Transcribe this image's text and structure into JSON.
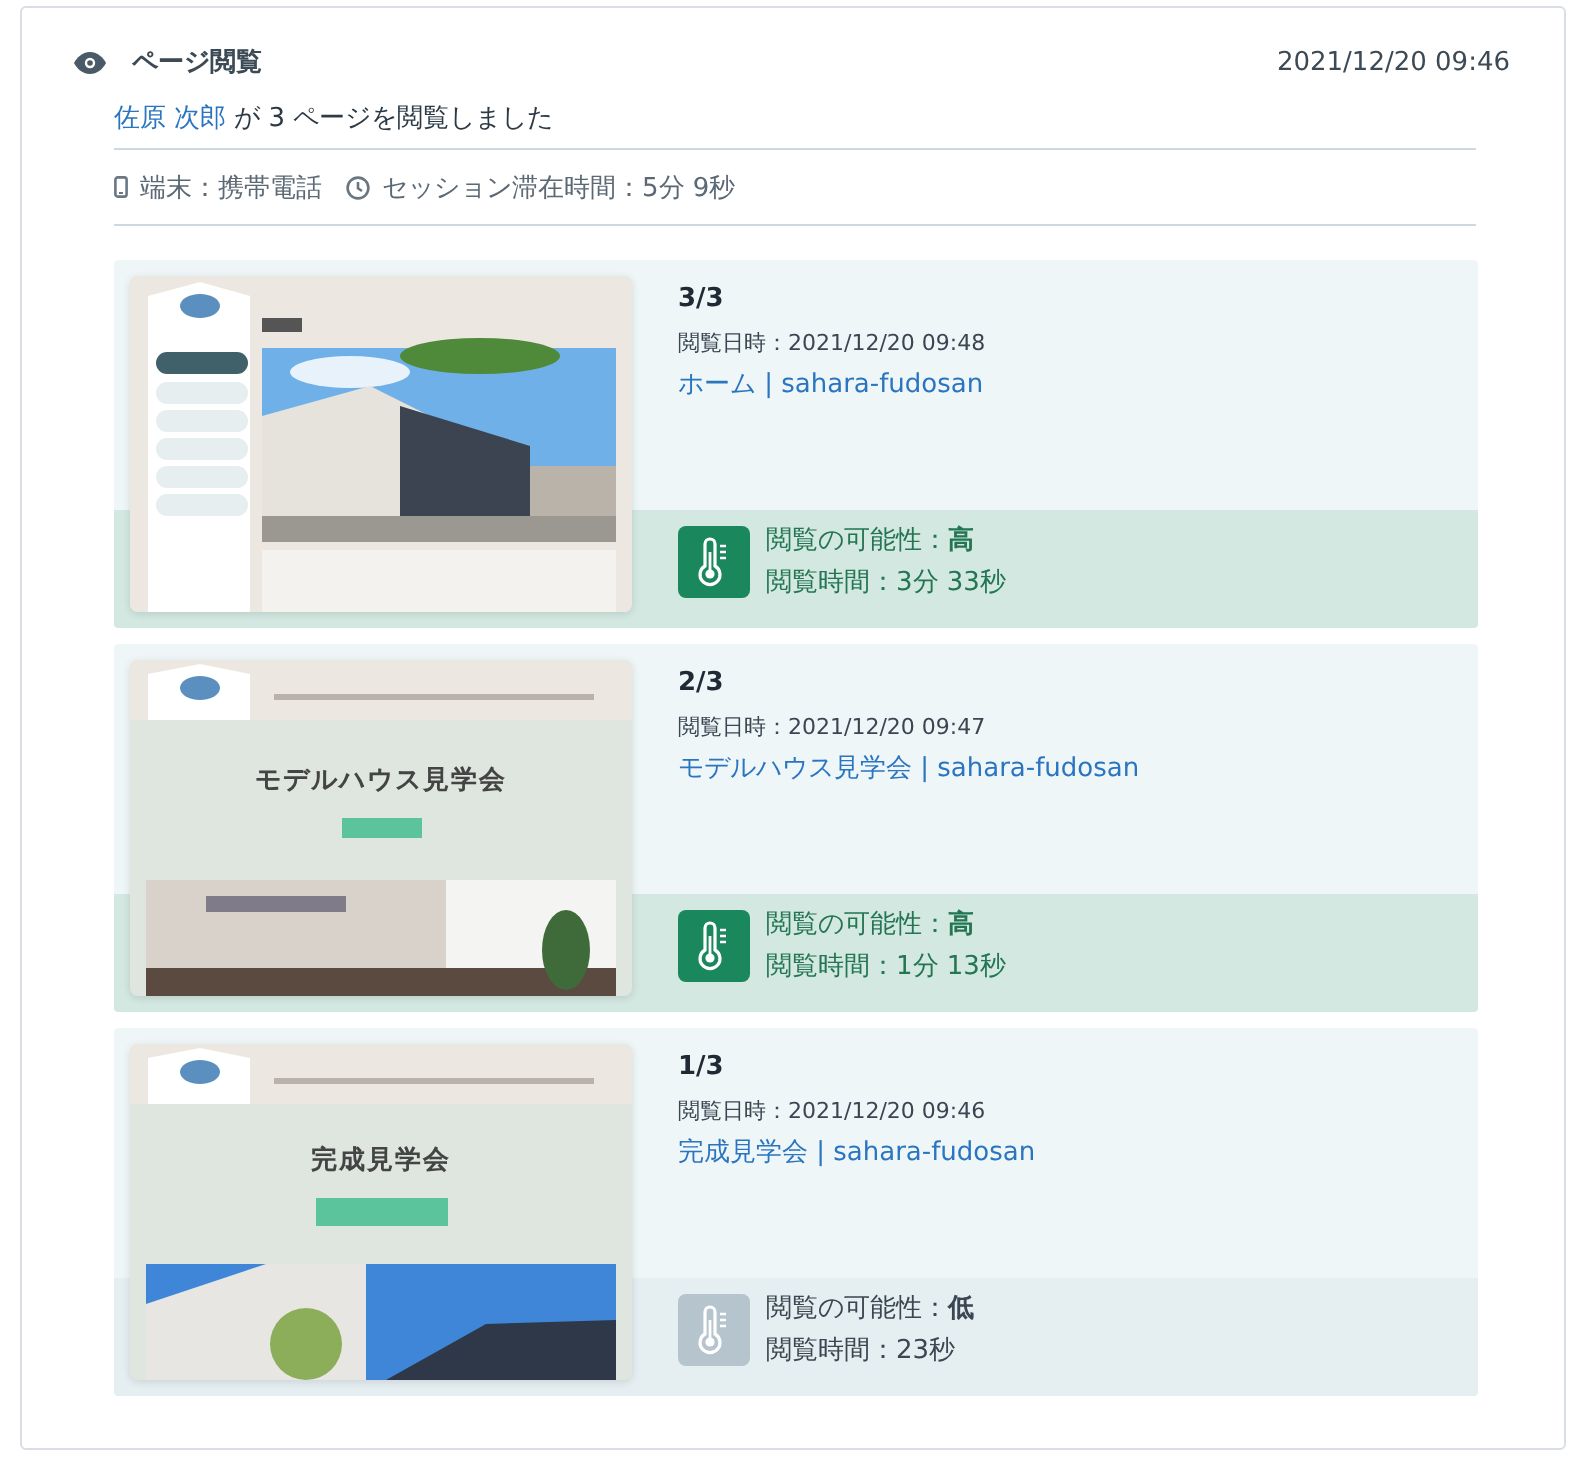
{
  "header": {
    "title": "ページ閲覧",
    "datetime": "2021/12/20 09:46"
  },
  "summary": {
    "user": "佐原 次郎",
    "text": "が 3 ページを閲覧しました"
  },
  "meta": [
    {
      "kind": "device",
      "text": "端末：携帯電話"
    },
    {
      "kind": "session",
      "text": "セッション滞在時間：5分 9秒"
    }
  ],
  "pages": [
    {
      "index": "3/3",
      "viewed_at": "閲覧日時：2021/12/20 09:48",
      "link": "ホーム | sahara-fudosan",
      "likelihood_label": "閲覧の可能性：",
      "likelihood": "高",
      "hot": true,
      "duration": "閲覧時間：3分 33秒",
      "thumbnail": {
        "kind": "home"
      }
    },
    {
      "index": "2/3",
      "viewed_at": "閲覧日時：2021/12/20 09:47",
      "link": "モデルハウス見学会 | sahara-fudosan",
      "likelihood_label": "閲覧の可能性：",
      "likelihood": "高",
      "hot": true,
      "duration": "閲覧時間：1分 13秒",
      "thumbnail": {
        "kind": "event",
        "heading": "モデルハウス見学会"
      }
    },
    {
      "index": "1/3",
      "viewed_at": "閲覧日時：2021/12/20 09:46",
      "link": "完成見学会 | sahara-fudosan",
      "likelihood_label": "閲覧の可能性：",
      "likelihood": "低",
      "hot": false,
      "duration": "閲覧時間：23秒",
      "thumbnail": {
        "kind": "event",
        "heading": "完成見学会"
      }
    }
  ]
}
